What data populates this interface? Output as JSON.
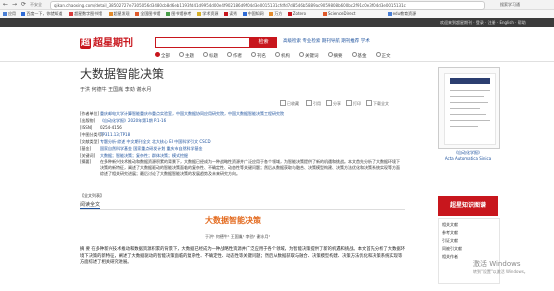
{
  "browser": {
    "nav_back": "←",
    "nav_forward": "→",
    "nav_reload": "⟳",
    "security": "不安全",
    "url": "qikan.chaoxing.com/detail_38502727e7305056d3480cb8d6eb1193fd41d9954d00e4f902186d9f04d3e0015131cfdfd7d8546b5889ac9059808b600bc2f91c0e3f04d3e0015131c",
    "right_tool": "搜索学习通",
    "bookmarks": [
      {
        "label": "应用",
        "color": "#4a7fd4"
      },
      {
        "label": "百度一下，你就知道",
        "color": "#2e6bd6"
      },
      {
        "label": "超星数字图书馆",
        "color": "#d83c3c"
      },
      {
        "label": "超星发现",
        "color": "#e38b2c"
      },
      {
        "label": "全国图书馆",
        "color": "#e05a2b"
      },
      {
        "label": "图书馆参考",
        "color": "#4a9e4a"
      },
      {
        "label": "学术资源",
        "color": "#d6b02a"
      },
      {
        "label": "读秀",
        "color": "#c8161d"
      },
      {
        "label": "中国知网",
        "color": "#2e6bd6"
      },
      {
        "label": "万方",
        "color": "#e38b2c"
      },
      {
        "label": "Zotero",
        "color": "#c8161d"
      },
      {
        "label": "ScienceDirect",
        "color": "#e05a2b"
      },
      {
        "label": "edu教育资源",
        "color": "#4a7fd4"
      }
    ]
  },
  "site": {
    "topbar_right": "欢迎来到超星期刊 · 登录 · 注册 · English · 帮助",
    "logo_glyph": "超",
    "logo_text": "超星期刊",
    "search_button": "检索",
    "advanced_links": "高级检索  专业检索  期刊导航  期刊推荐  学术",
    "search_scopes": [
      {
        "label": "全部",
        "selected": true
      },
      {
        "label": "主题",
        "selected": false
      },
      {
        "label": "标题",
        "selected": false
      },
      {
        "label": "作者",
        "selected": false
      },
      {
        "label": "刊名",
        "selected": false
      },
      {
        "label": "机构",
        "selected": false
      },
      {
        "label": "关键词",
        "selected": false
      },
      {
        "label": "摘要",
        "selected": false
      },
      {
        "label": "基金",
        "selected": false
      },
      {
        "label": "正文",
        "selected": false
      }
    ]
  },
  "article": {
    "title": "大数据智能决策",
    "authors": "于洪  何德牛  王国胤  李劲  谢水月",
    "tools": [
      "已收藏",
      "引用",
      "分享",
      "打印",
      "下载全文"
    ],
    "meta": [
      {
        "key": "[作者单位]",
        "value": "重庆邮电大学计算智能重庆市重点实验室，中国大数据协同应用研究院，中国大数据智能决策工程研究院"
      },
      {
        "key": "[出版物]",
        "value": "《自动化学报》2020年第1期 P.1-16",
        "plain": true
      },
      {
        "key": "[ISSN]",
        "value": "0254-4156",
        "plain": true
      },
      {
        "key": "[中图分类号]",
        "value": "TP311.13;TP18",
        "plain": true
      },
      {
        "key": "[文献类型]",
        "value": "专题分析·综述 中文期刊全文 北大核心 EI 中国科学引文 CSCD"
      },
      {
        "key": "[基金]",
        "value": "国家自然科学基金 国家重点研发计划 重庆市自然科学基金"
      },
      {
        "key": "[关键词]",
        "value": "大数据；智能决策；复杂性；群体决策；模式挖掘"
      },
      {
        "key": "[摘要]",
        "value": "",
        "plain": true
      }
    ],
    "abstract": "在多种新兴技术推动和数据资源积累的背景下，大数据已经成为一种战略性资源并广泛应用于各个领域，为智能决策提供了新的机遇和挑战。本文首先分析了大数据环境下决策的新特征，阐述了大数据驱动的智能决策面临的复杂性、不确定性、动态性等关键问题；然后从数据获取与融合、决策模型构建、决策方法优化和决策系统实现等方面综述了相关研究进展；最后讨论了大数据智能决策的发展趋势及未来研究方向。",
    "abstract_more": "【全文列表】 ",
    "read_tab": "阅读全文"
  },
  "body": {
    "title": "大数据智能决策",
    "authors": "于洪¹  何德牛¹  王国胤¹  李劲¹  谢水月¹",
    "text": "摘  要  在多种新兴技术推动和数据资源积累的背景下，大数据已经成为一种战略性资源并广泛应用于各个领域，为智能决策提供了新的机遇和挑战。本文首先分析了大数据环境下决策的新特征，阐述了大数据驱动的智能决策面临的复杂性、不确定性、动态性等关键问题；然后从数据获取与融合、决策模型构建、决策方法优化和决策系统实现等方面综述了相关研究进展。"
  },
  "sidebar": {
    "cover_caption": "《自动化学报》",
    "cover_caption2": "Acta Automatica Sinica",
    "knowledge_button": "超星知识图谱",
    "links": [
      "相关文献",
      "参考文献",
      "引证文献",
      "同被引文献",
      "相关作者"
    ]
  },
  "windows": {
    "activate": "激活 Windows",
    "activate_hint": "转到\"设置\"以激活 Windows。"
  }
}
